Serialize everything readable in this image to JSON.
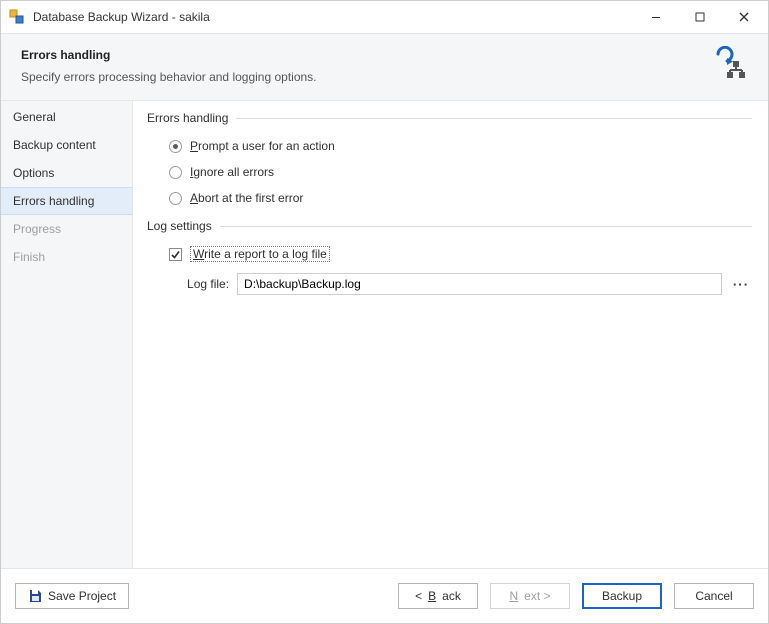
{
  "window": {
    "title": "Database Backup Wizard - sakila"
  },
  "header": {
    "title": "Errors handling",
    "subtitle": "Specify errors processing behavior and logging options."
  },
  "sidebar": {
    "steps": [
      {
        "label": "General",
        "active": false,
        "disabled": false
      },
      {
        "label": "Backup content",
        "active": false,
        "disabled": false
      },
      {
        "label": "Options",
        "active": false,
        "disabled": false
      },
      {
        "label": "Errors handling",
        "active": true,
        "disabled": false
      },
      {
        "label": "Progress",
        "active": false,
        "disabled": true
      },
      {
        "label": "Finish",
        "active": false,
        "disabled": true
      }
    ]
  },
  "errors_group": {
    "title": "Errors handling",
    "options": {
      "prompt": "Prompt a user for an action",
      "ignore": "Ignore all errors",
      "abort": "Abort at the first error"
    },
    "selected": "prompt"
  },
  "log_group": {
    "title": "Log settings",
    "write_label": "Write a report to a log file",
    "write_checked": true,
    "logfile_label": "Log file:",
    "logfile_value": "D:\\backup\\Backup.log",
    "browse_label": "···"
  },
  "footer": {
    "save_project": "Save Project",
    "back": "< Back",
    "next": "Next >",
    "primary": "Backup",
    "cancel": "Cancel",
    "next_enabled": false
  }
}
